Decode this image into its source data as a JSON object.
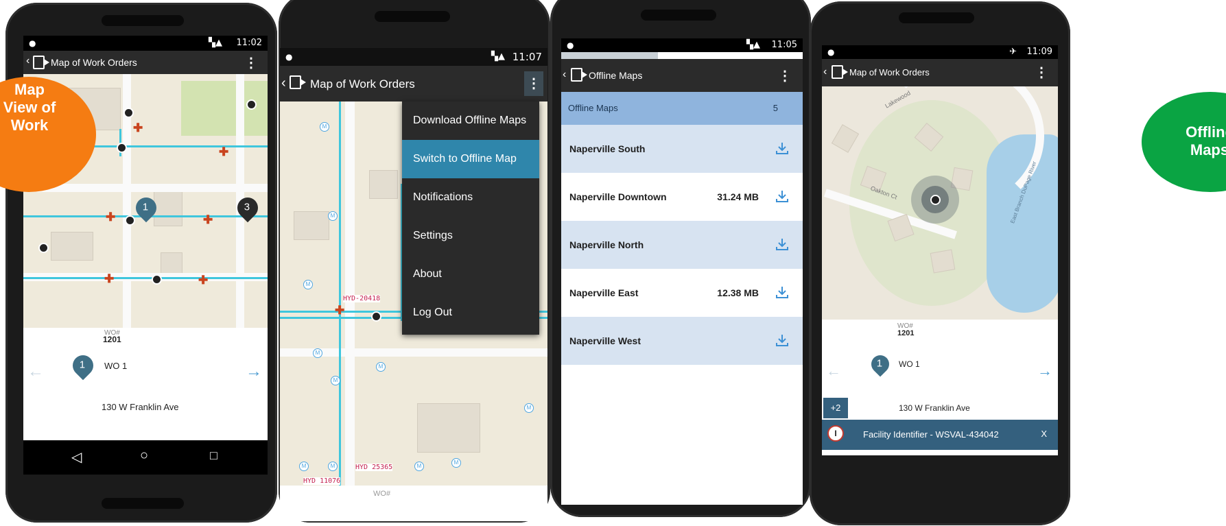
{
  "colors": {
    "orange_badge": "#f57c12",
    "green_badge": "#0aa443",
    "pipe": "#3fc6dd",
    "pin": "#3f6f86",
    "menu_highlight": "#2f86ab",
    "list_header": "#8fb4dd",
    "list_row_alt": "#d7e3f1",
    "facility_bar": "#34607e"
  },
  "badges": {
    "left": "Map View of Work",
    "right": "Offline Maps"
  },
  "phone1": {
    "status_time": "11:02",
    "title": "Map of Work Orders",
    "pin_label": "1",
    "cluster_label": "3",
    "wo_label": "WO#",
    "wo_number": "1201",
    "work_order": "WO 1",
    "address": "130 W Franklin Ave",
    "icons": {
      "back": "back-icon",
      "prev": "arrow-left-icon",
      "next": "arrow-right-icon",
      "nav_back": "nav-back-icon",
      "nav_home": "nav-home-icon",
      "nav_recent": "nav-recent-icon"
    }
  },
  "phone2": {
    "status_time": "11:07",
    "title": "Map of Work Orders",
    "menu_items": [
      "Download Offline Maps",
      "Switch to Offline Map",
      "Notifications",
      "Settings",
      "About",
      "Log Out"
    ],
    "hydrant_1": "HYD-20418",
    "hydrant_2": "HYD 25365",
    "hydrant_3": "HYD 11076",
    "wo_label": "WO#"
  },
  "phone3": {
    "status_time": "11:05",
    "title": "Offline Maps",
    "header_label": "Offline Maps",
    "header_count": "5",
    "maps": [
      {
        "name": "Naperville South",
        "size": ""
      },
      {
        "name": "Naperville Downtown",
        "size": "31.24 MB"
      },
      {
        "name": "Naperville North",
        "size": ""
      },
      {
        "name": "Naperville East",
        "size": "12.38 MB"
      },
      {
        "name": "Naperville West",
        "size": ""
      }
    ]
  },
  "phone4": {
    "status_time": "11:09",
    "title": "Map of Work Orders",
    "street_1": "Lakewood",
    "street_2": "Oakton Ct",
    "river": "East Branch DuPage River",
    "wo_label": "WO#",
    "wo_number": "1201",
    "work_order": "WO 1",
    "address": "130 W Franklin Ave",
    "plus_badge": "+2",
    "facility": "Facility Identifier - WSVAL-434042",
    "close": "X"
  }
}
